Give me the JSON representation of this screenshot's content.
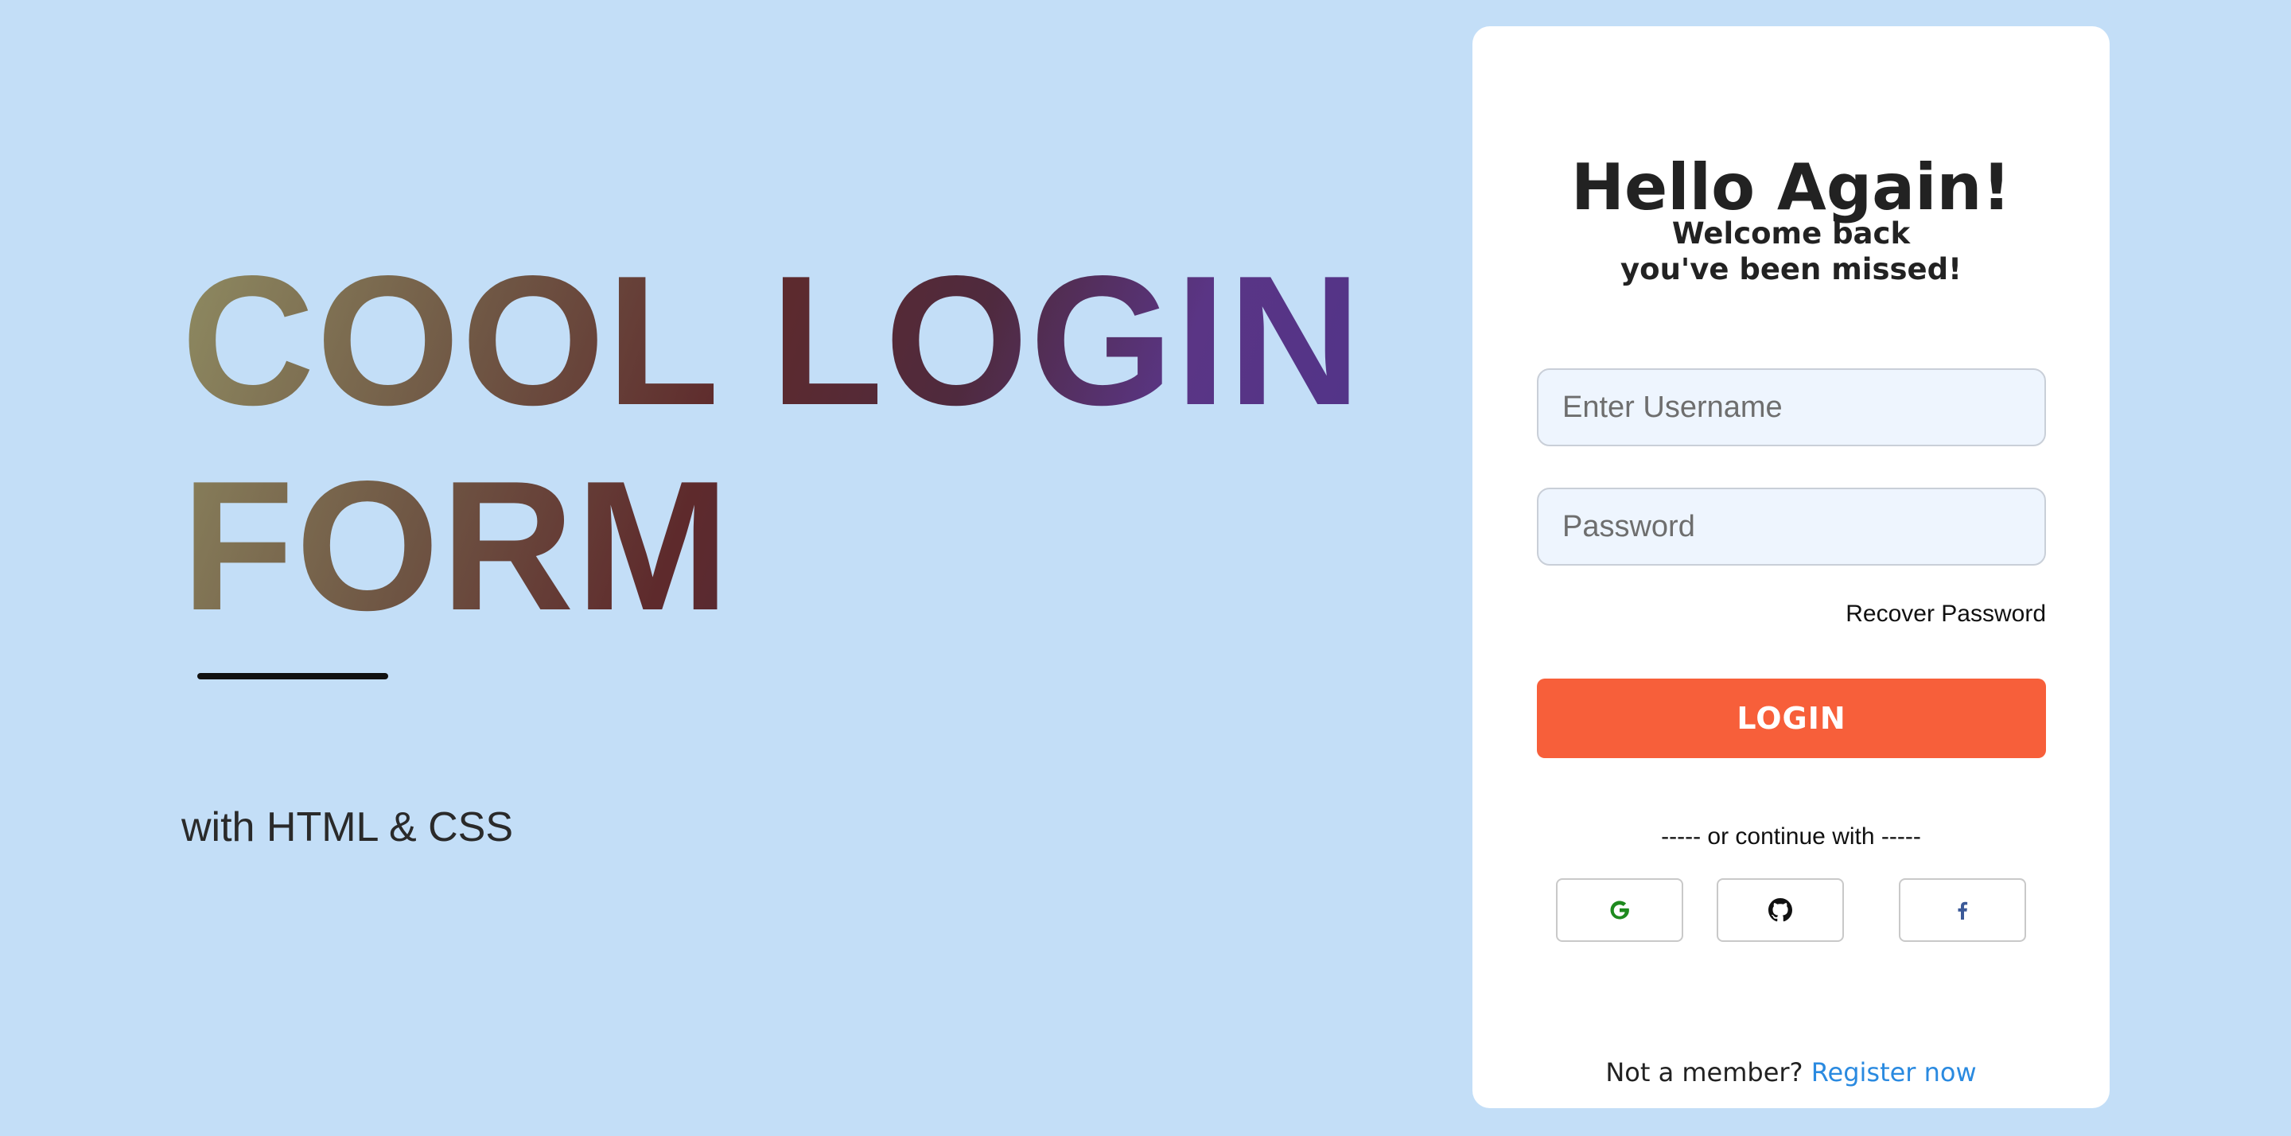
{
  "hero": {
    "title_line1": "COOL LOGIN",
    "title_line2": "FORM",
    "subtitle": "with HTML & CSS"
  },
  "login": {
    "title": "Hello Again!",
    "subtitle": "Welcome back you've been missed!",
    "username_placeholder": "Enter Username",
    "password_placeholder": "Password",
    "recover_label": "Recover Password",
    "login_button_label": "LOGIN",
    "divider_text": "----- or continue with -----",
    "social_buttons": [
      {
        "icon": "google-icon",
        "color": "#1e8a1e"
      },
      {
        "icon": "github-icon",
        "color": "#111111"
      },
      {
        "icon": "facebook-icon",
        "color": "#3b5998"
      }
    ],
    "footer_prefix": "Not a member?",
    "register_label": "Register now"
  },
  "colors": {
    "background": "#c3def7",
    "card": "#ffffff",
    "accent": "#f75f3a",
    "link": "#2a8ae0",
    "field_bg": "#eef5fe"
  }
}
